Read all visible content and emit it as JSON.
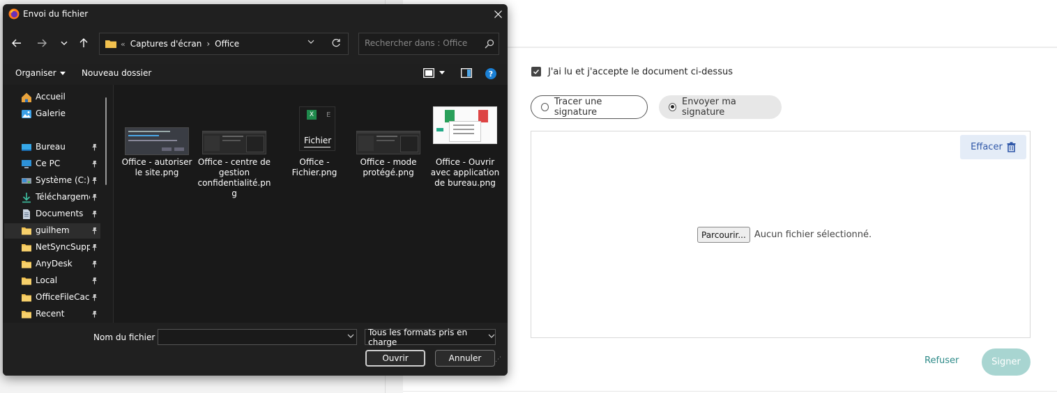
{
  "page": {
    "accept_label": "J'ai lu et j'accepte le document ci-dessus",
    "accept_checked": true,
    "signature_options": [
      {
        "label": "Tracer une signature",
        "selected": false
      },
      {
        "label": "Envoyer ma signature",
        "selected": true
      }
    ],
    "clear_label": "Effacer",
    "browse_label": "Parcourir...",
    "no_file_label": "Aucun fichier sélectionné.",
    "refuse_label": "Refuser",
    "sign_label": "Signer",
    "colors": {
      "accent": "#2d8a88",
      "sign_disabled": "#a8d5d1",
      "clear_bg": "#e4ecf7",
      "clear_text": "#2f57a8"
    }
  },
  "dialog": {
    "title": "Envoi du fichier",
    "title_icon": "firefox-icon",
    "address": {
      "overflow": "«",
      "parts": [
        "Captures d'écran",
        "Office"
      ],
      "separator": "›"
    },
    "search_placeholder": "Rechercher dans : Office",
    "toolbar": {
      "organize": "Organiser",
      "new_folder": "Nouveau dossier"
    },
    "nav_items": [
      {
        "label": "Accueil",
        "icon": "home-icon",
        "pinned": false
      },
      {
        "label": "Galerie",
        "icon": "gallery-icon",
        "pinned": false
      },
      {
        "label": "Bureau",
        "icon": "desktop-icon",
        "pinned": true
      },
      {
        "label": "Ce PC",
        "icon": "computer-icon",
        "pinned": true
      },
      {
        "label": "Système (C:)",
        "icon": "drive-icon",
        "pinned": true
      },
      {
        "label": "Téléchargements",
        "icon": "download-icon",
        "pinned": true
      },
      {
        "label": "Documents",
        "icon": "documents-icon",
        "pinned": true
      },
      {
        "label": "guilhem",
        "icon": "folder-icon",
        "pinned": true,
        "selected": true
      },
      {
        "label": "NetSyncSupport",
        "icon": "folder-icon",
        "pinned": true
      },
      {
        "label": "AnyDesk",
        "icon": "folder-icon",
        "pinned": true
      },
      {
        "label": "Local",
        "icon": "folder-icon",
        "pinned": true
      },
      {
        "label": "OfficeFileCache",
        "icon": "folder-icon",
        "pinned": true
      },
      {
        "label": "Recent",
        "icon": "folder-icon",
        "pinned": true
      }
    ],
    "files": [
      {
        "name": "Office - autoriser le site.png",
        "thumb": "dialog"
      },
      {
        "name": "Office - centre de gestion confidentialité.png",
        "thumb": "dark-window"
      },
      {
        "name": "Office - Fichier.png",
        "thumb": "excel",
        "thumb_text": "Fichier",
        "thumb_letter": "E"
      },
      {
        "name": "Office - mode protégé.png",
        "thumb": "dark-window"
      },
      {
        "name": "Office - Ouvrir avec application de bureau.png",
        "thumb": "light-menu"
      }
    ],
    "filename_label": "Nom du fichier :",
    "filename_value": "",
    "filetype": "Tous les formats pris en charge",
    "open_label": "Ouvrir",
    "cancel_label": "Annuler"
  }
}
